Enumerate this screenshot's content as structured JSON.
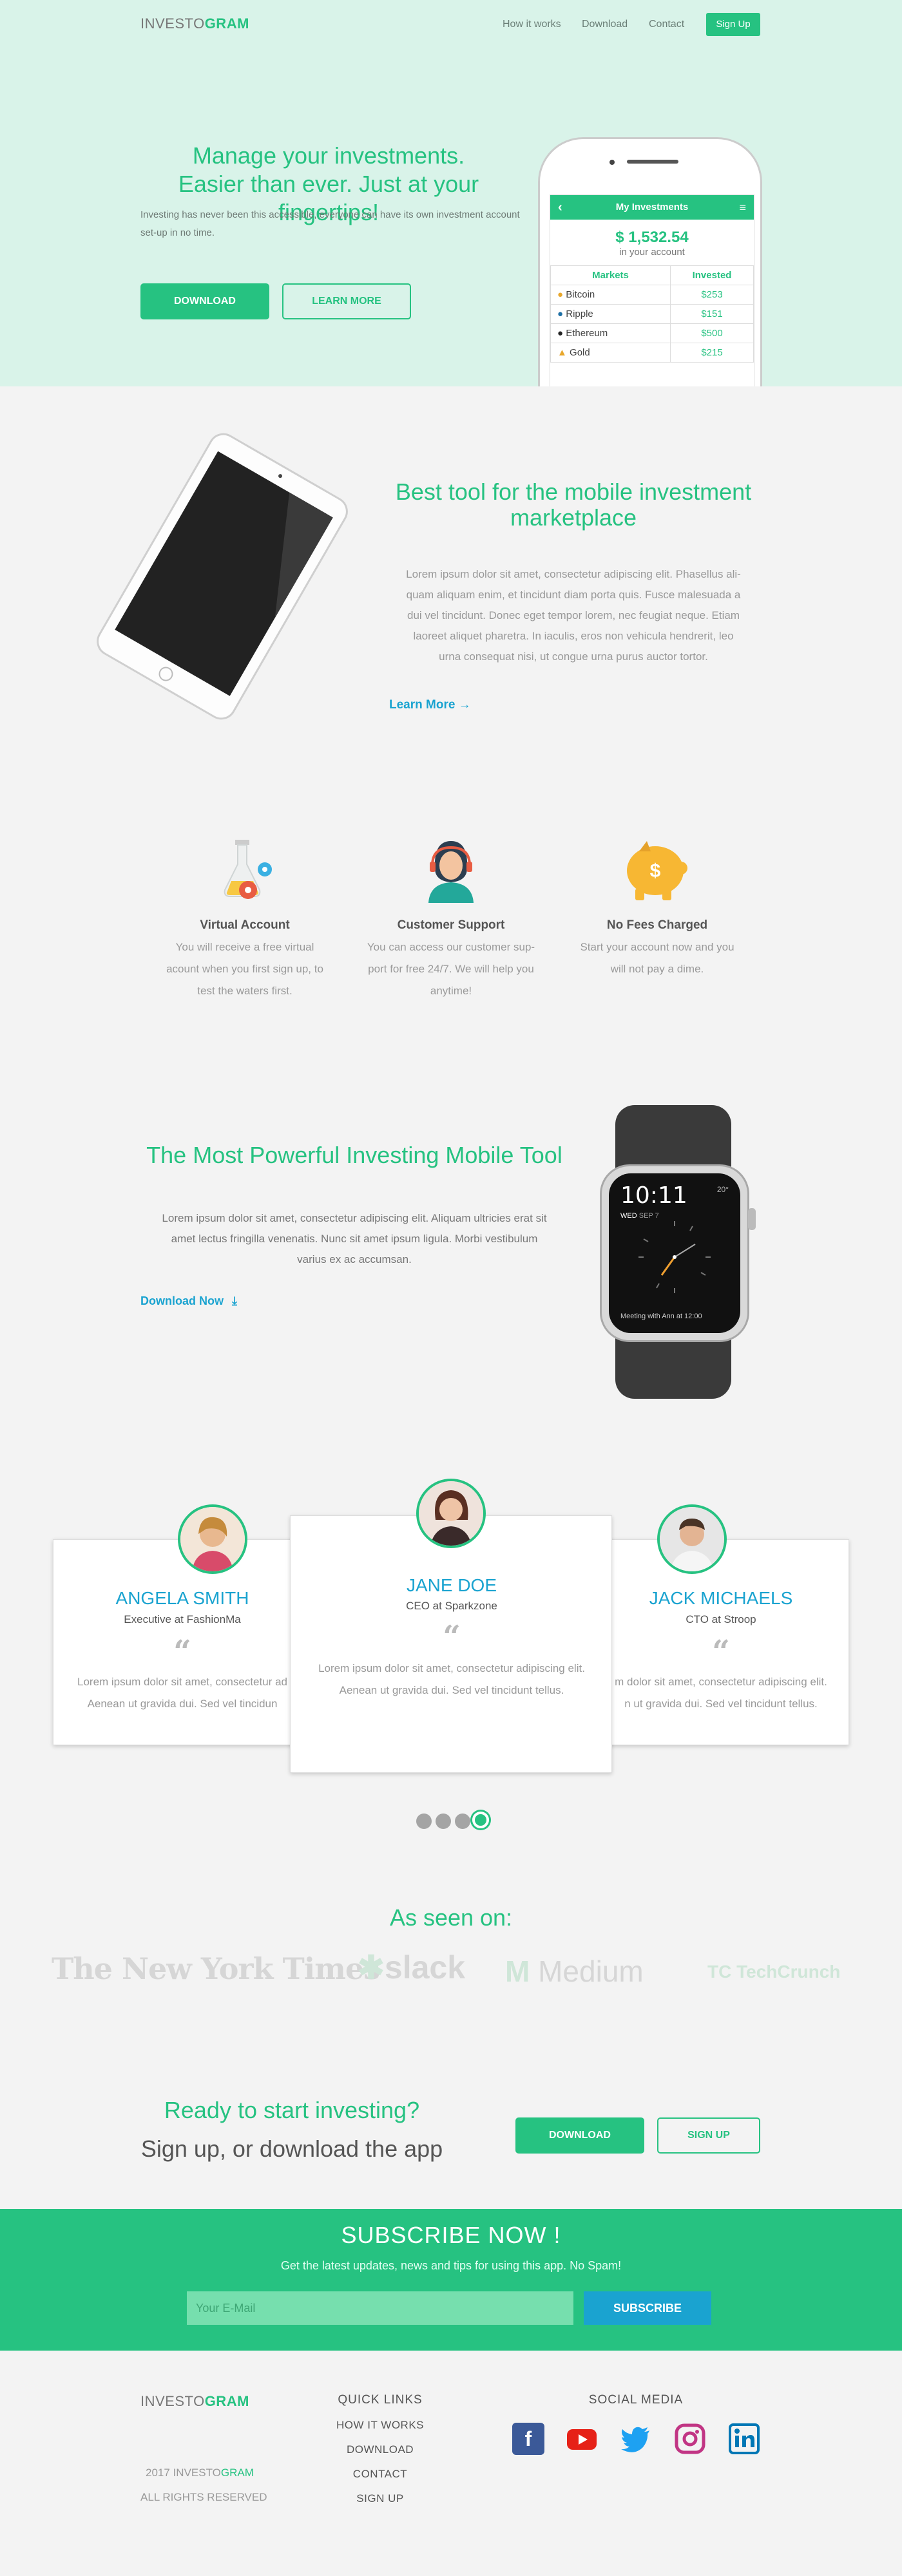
{
  "brand": {
    "prefix": "INVESTO",
    "suffix": "GRAM"
  },
  "nav": {
    "items": [
      "How it works",
      "Download",
      "Contact"
    ],
    "signup": "Sign Up"
  },
  "hero": {
    "title_line1": "Manage your investments.",
    "title_line2": "Easier than ever. Just at your fingertips!",
    "text": "Investing has never been this accessible, everyone can  have its own investment account set-up in no time.",
    "download": "DOWNLOAD",
    "learn_more": "LEARN MORE"
  },
  "phone_app": {
    "title": "My Investments",
    "balance": "$ 1,532.54",
    "balance_label": "in your account",
    "headers": [
      "Markets",
      "Invested"
    ],
    "rows": [
      {
        "market": "Bitcoin",
        "invested": "$253",
        "icon": "bitcoin-icon"
      },
      {
        "market": "Ripple",
        "invested": "$151",
        "icon": "ripple-icon"
      },
      {
        "market": "Ethereum",
        "invested": "$500",
        "icon": "ethereum-icon"
      },
      {
        "market": "Gold",
        "invested": "$215",
        "icon": "gold-icon"
      }
    ]
  },
  "tool": {
    "title_line1": "Best tool for the mobile investment",
    "title_line2": "marketplace",
    "text_lines": [
      "Lorem ipsum dolor sit amet, consectetur adipiscing elit. Phasellus ali-",
      "quam aliquam enim, et tincidunt diam porta quis. Fusce malesuada a",
      "dui vel tincidunt. Donec eget tempor lorem, nec feugiat neque. Etiam",
      "laoreet aliquet pharetra. In iaculis, eros non vehicula hendrerit, leo",
      "urna consequat nisi, ut congue urna purus auctor tortor."
    ],
    "learn_more": "Learn More"
  },
  "features": [
    {
      "title": "Virtual Account",
      "lines": [
        "You will receive a free virtual",
        "acount when you first sign up, to",
        "test the waters first."
      ]
    },
    {
      "title": "Customer Support",
      "lines": [
        "You can access our customer sup-",
        "port for free 24/7. We will help you",
        "anytime!"
      ]
    },
    {
      "title": "No Fees Charged",
      "lines": [
        "Start your account now and you",
        "will not pay a dime."
      ]
    }
  ],
  "powerful": {
    "title": "The Most Powerful Investing Mobile Tool",
    "text_lines": [
      "Lorem ipsum dolor sit amet, consectetur adipiscing elit. Aliquam ultricies erat sit",
      "amet lectus fringilla venenatis. Nunc sit amet ipsum ligula. Morbi vestibulum",
      "varius ex ac accumsan."
    ],
    "download_now": "Download Now"
  },
  "watch": {
    "time": "10:11",
    "temp": "20°",
    "date_day": "WED",
    "date_num": "SEP",
    "date_val": "7",
    "event": "Meeting with Ann at 12:00"
  },
  "testimonials": [
    {
      "name": "ANGELA SMITH",
      "role": "Executive at FashionMa",
      "quote": "“",
      "lines": [
        "Lorem ipsum dolor sit amet, consectetur ad",
        "Aenean ut gravida dui. Sed vel tincidun"
      ]
    },
    {
      "name": "JANE DOE",
      "role": "CEO at Sparkzone",
      "quote": "“",
      "lines": [
        "Lorem ipsum dolor sit amet, consectetur adipiscing elit.",
        "Aenean ut gravida dui. Sed vel tincidunt tellus."
      ]
    },
    {
      "name": "JACK MICHAELS",
      "role": "CTO at Stroop",
      "quote": "“",
      "lines": [
        "m dolor sit amet, consectetur adipiscing elit.",
        "n ut gravida dui. Sed vel tincidunt tellus."
      ]
    }
  ],
  "press": {
    "title": "As seen on:",
    "logos": [
      "The New York Times",
      "slack",
      "Medium",
      "TechCrunch"
    ]
  },
  "cta": {
    "title": "Ready to start investing?",
    "subtitle": "Sign up, or download the app",
    "download": "DOWNLOAD",
    "signup": "SIGN UP"
  },
  "subscribe": {
    "title": "SUBSCRIBE NOW !",
    "text": "Get the latest updates, news and tips for using this app. No Spam!",
    "placeholder": "Your E-Mail",
    "button": "SUBSCRIBE"
  },
  "footer": {
    "quick_links_title": "QUICK LINKS",
    "links": [
      "HOW IT WORKS",
      "DOWNLOAD",
      "CONTACT",
      "SIGN UP"
    ],
    "social_title": "SOCIAL MEDIA",
    "copy_year": "2017",
    "rights": "ALL RIGHTS RESERVED"
  },
  "colors": {
    "brand_green": "#26c281",
    "accent_blue": "#1aa3d0",
    "hero_bg": "#d9f3e9"
  }
}
